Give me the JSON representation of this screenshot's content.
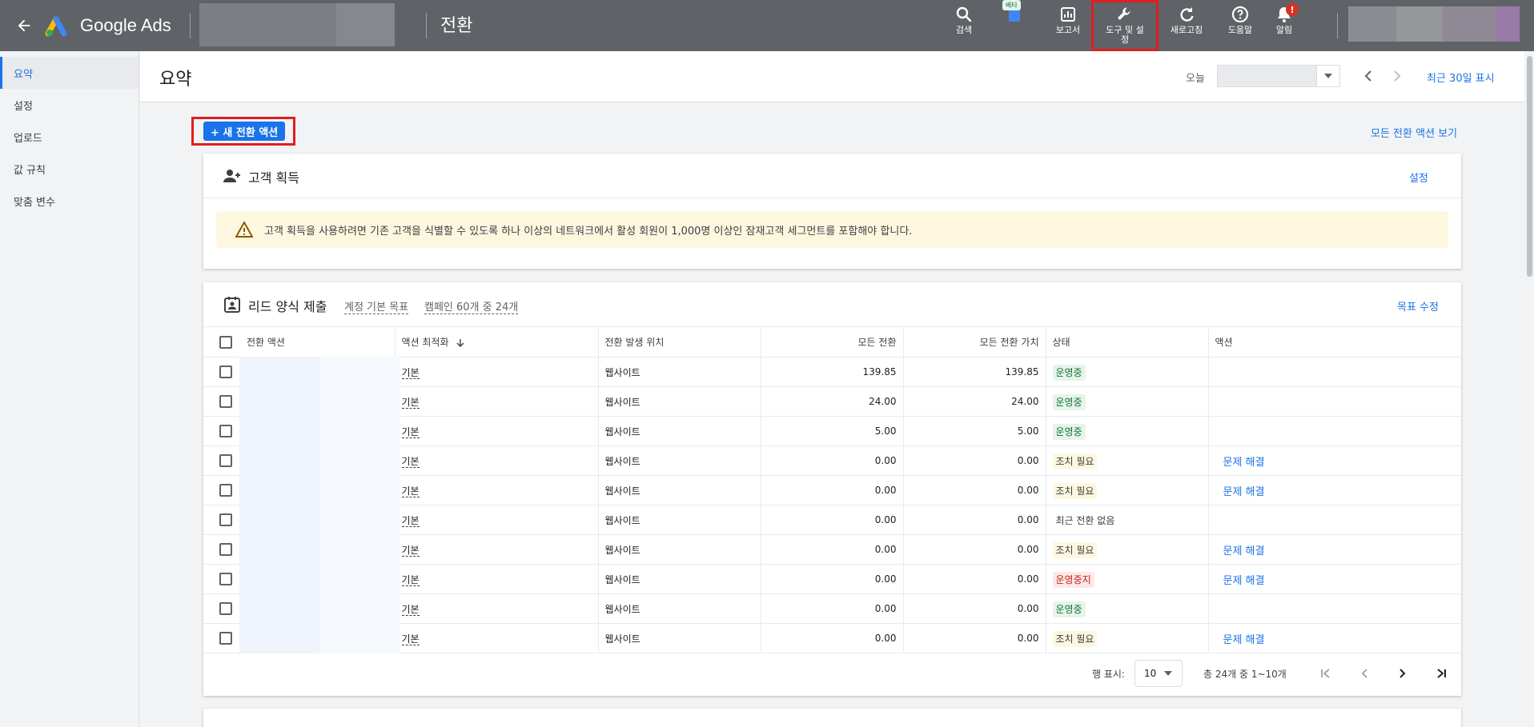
{
  "topbar": {
    "brand": "Google Ads",
    "page_title": "전환",
    "tools": [
      {
        "label": "검색",
        "icon": "search-icon"
      },
      {
        "label": "",
        "icon": "campaigns-icon"
      },
      {
        "label": "보고서",
        "icon": "reports-icon"
      },
      {
        "label": "도구 및 설정",
        "icon": "wrench-icon"
      },
      {
        "label": "새로고침",
        "icon": "refresh-icon"
      },
      {
        "label": "도움말",
        "icon": "help-icon"
      },
      {
        "label": "알림",
        "icon": "bell-icon"
      }
    ],
    "beta_badge": "베타",
    "alert_mark": "!"
  },
  "sidebar": {
    "items": [
      {
        "label": "요약",
        "active": true
      },
      {
        "label": "설정",
        "active": false
      },
      {
        "label": "업로드",
        "active": false
      },
      {
        "label": "값 규칙",
        "active": false
      },
      {
        "label": "맞춤 변수",
        "active": false
      }
    ]
  },
  "header": {
    "title": "요약",
    "today_label": "오늘",
    "recent_link": "최근 30일 표시"
  },
  "actions": {
    "new_button": "+ 새 전환 액션",
    "all_link": "모든 전환 액션 보기"
  },
  "acquisition_card": {
    "title": "고객 획득",
    "settings_link": "설정",
    "warning": "고객 획득을 사용하려면 기존 고객을 식별할 수 있도록 하나 이상의 네트워크에서 활성 회원이 1,000명 이상인 잠재고객 세그먼트를 포함해야 합니다."
  },
  "lead_card": {
    "title": "리드 양식 제출",
    "tag_default": "계정 기본 목표",
    "tag_campaigns": "캠페인 60개 중 24개",
    "edit_link": "목표 수정",
    "columns": [
      "전환 액션",
      "액션 최적화",
      "전환 발생 위치",
      "모든 전환",
      "모든 전환 가치",
      "상태",
      "액션"
    ],
    "rows": [
      {
        "optimization": "기본",
        "source": "웹사이트",
        "conversions": "139.85",
        "value": "139.85",
        "status": "운영중",
        "status_type": "ok",
        "action": ""
      },
      {
        "optimization": "기본",
        "source": "웹사이트",
        "conversions": "24.00",
        "value": "24.00",
        "status": "운영중",
        "status_type": "ok",
        "action": ""
      },
      {
        "optimization": "기본",
        "source": "웹사이트",
        "conversions": "5.00",
        "value": "5.00",
        "status": "운영중",
        "status_type": "ok",
        "action": ""
      },
      {
        "optimization": "기본",
        "source": "웹사이트",
        "conversions": "0.00",
        "value": "0.00",
        "status": "조치 필요",
        "status_type": "warn",
        "action": "문제 해결"
      },
      {
        "optimization": "기본",
        "source": "웹사이트",
        "conversions": "0.00",
        "value": "0.00",
        "status": "조치 필요",
        "status_type": "warn",
        "action": "문제 해결"
      },
      {
        "optimization": "기본",
        "source": "웹사이트",
        "conversions": "0.00",
        "value": "0.00",
        "status": "최근 전환 없음",
        "status_type": "none",
        "action": ""
      },
      {
        "optimization": "기본",
        "source": "웹사이트",
        "conversions": "0.00",
        "value": "0.00",
        "status": "조치 필요",
        "status_type": "warn",
        "action": "문제 해결"
      },
      {
        "optimization": "기본",
        "source": "웹사이트",
        "conversions": "0.00",
        "value": "0.00",
        "status": "운영중지",
        "status_type": "stop",
        "action": "문제 해결"
      },
      {
        "optimization": "기본",
        "source": "웹사이트",
        "conversions": "0.00",
        "value": "0.00",
        "status": "운영중",
        "status_type": "ok",
        "action": ""
      },
      {
        "optimization": "기본",
        "source": "웹사이트",
        "conversions": "0.00",
        "value": "0.00",
        "status": "조치 필요",
        "status_type": "warn",
        "action": "문제 해결"
      }
    ],
    "pager": {
      "rows_label": "행 표시:",
      "rows_value": "10",
      "range": "총 24개 중 1~10개"
    }
  },
  "colors": {
    "accent": "#1a73e8",
    "topbar": "#5f6368",
    "highlight": "#e01e1e"
  }
}
